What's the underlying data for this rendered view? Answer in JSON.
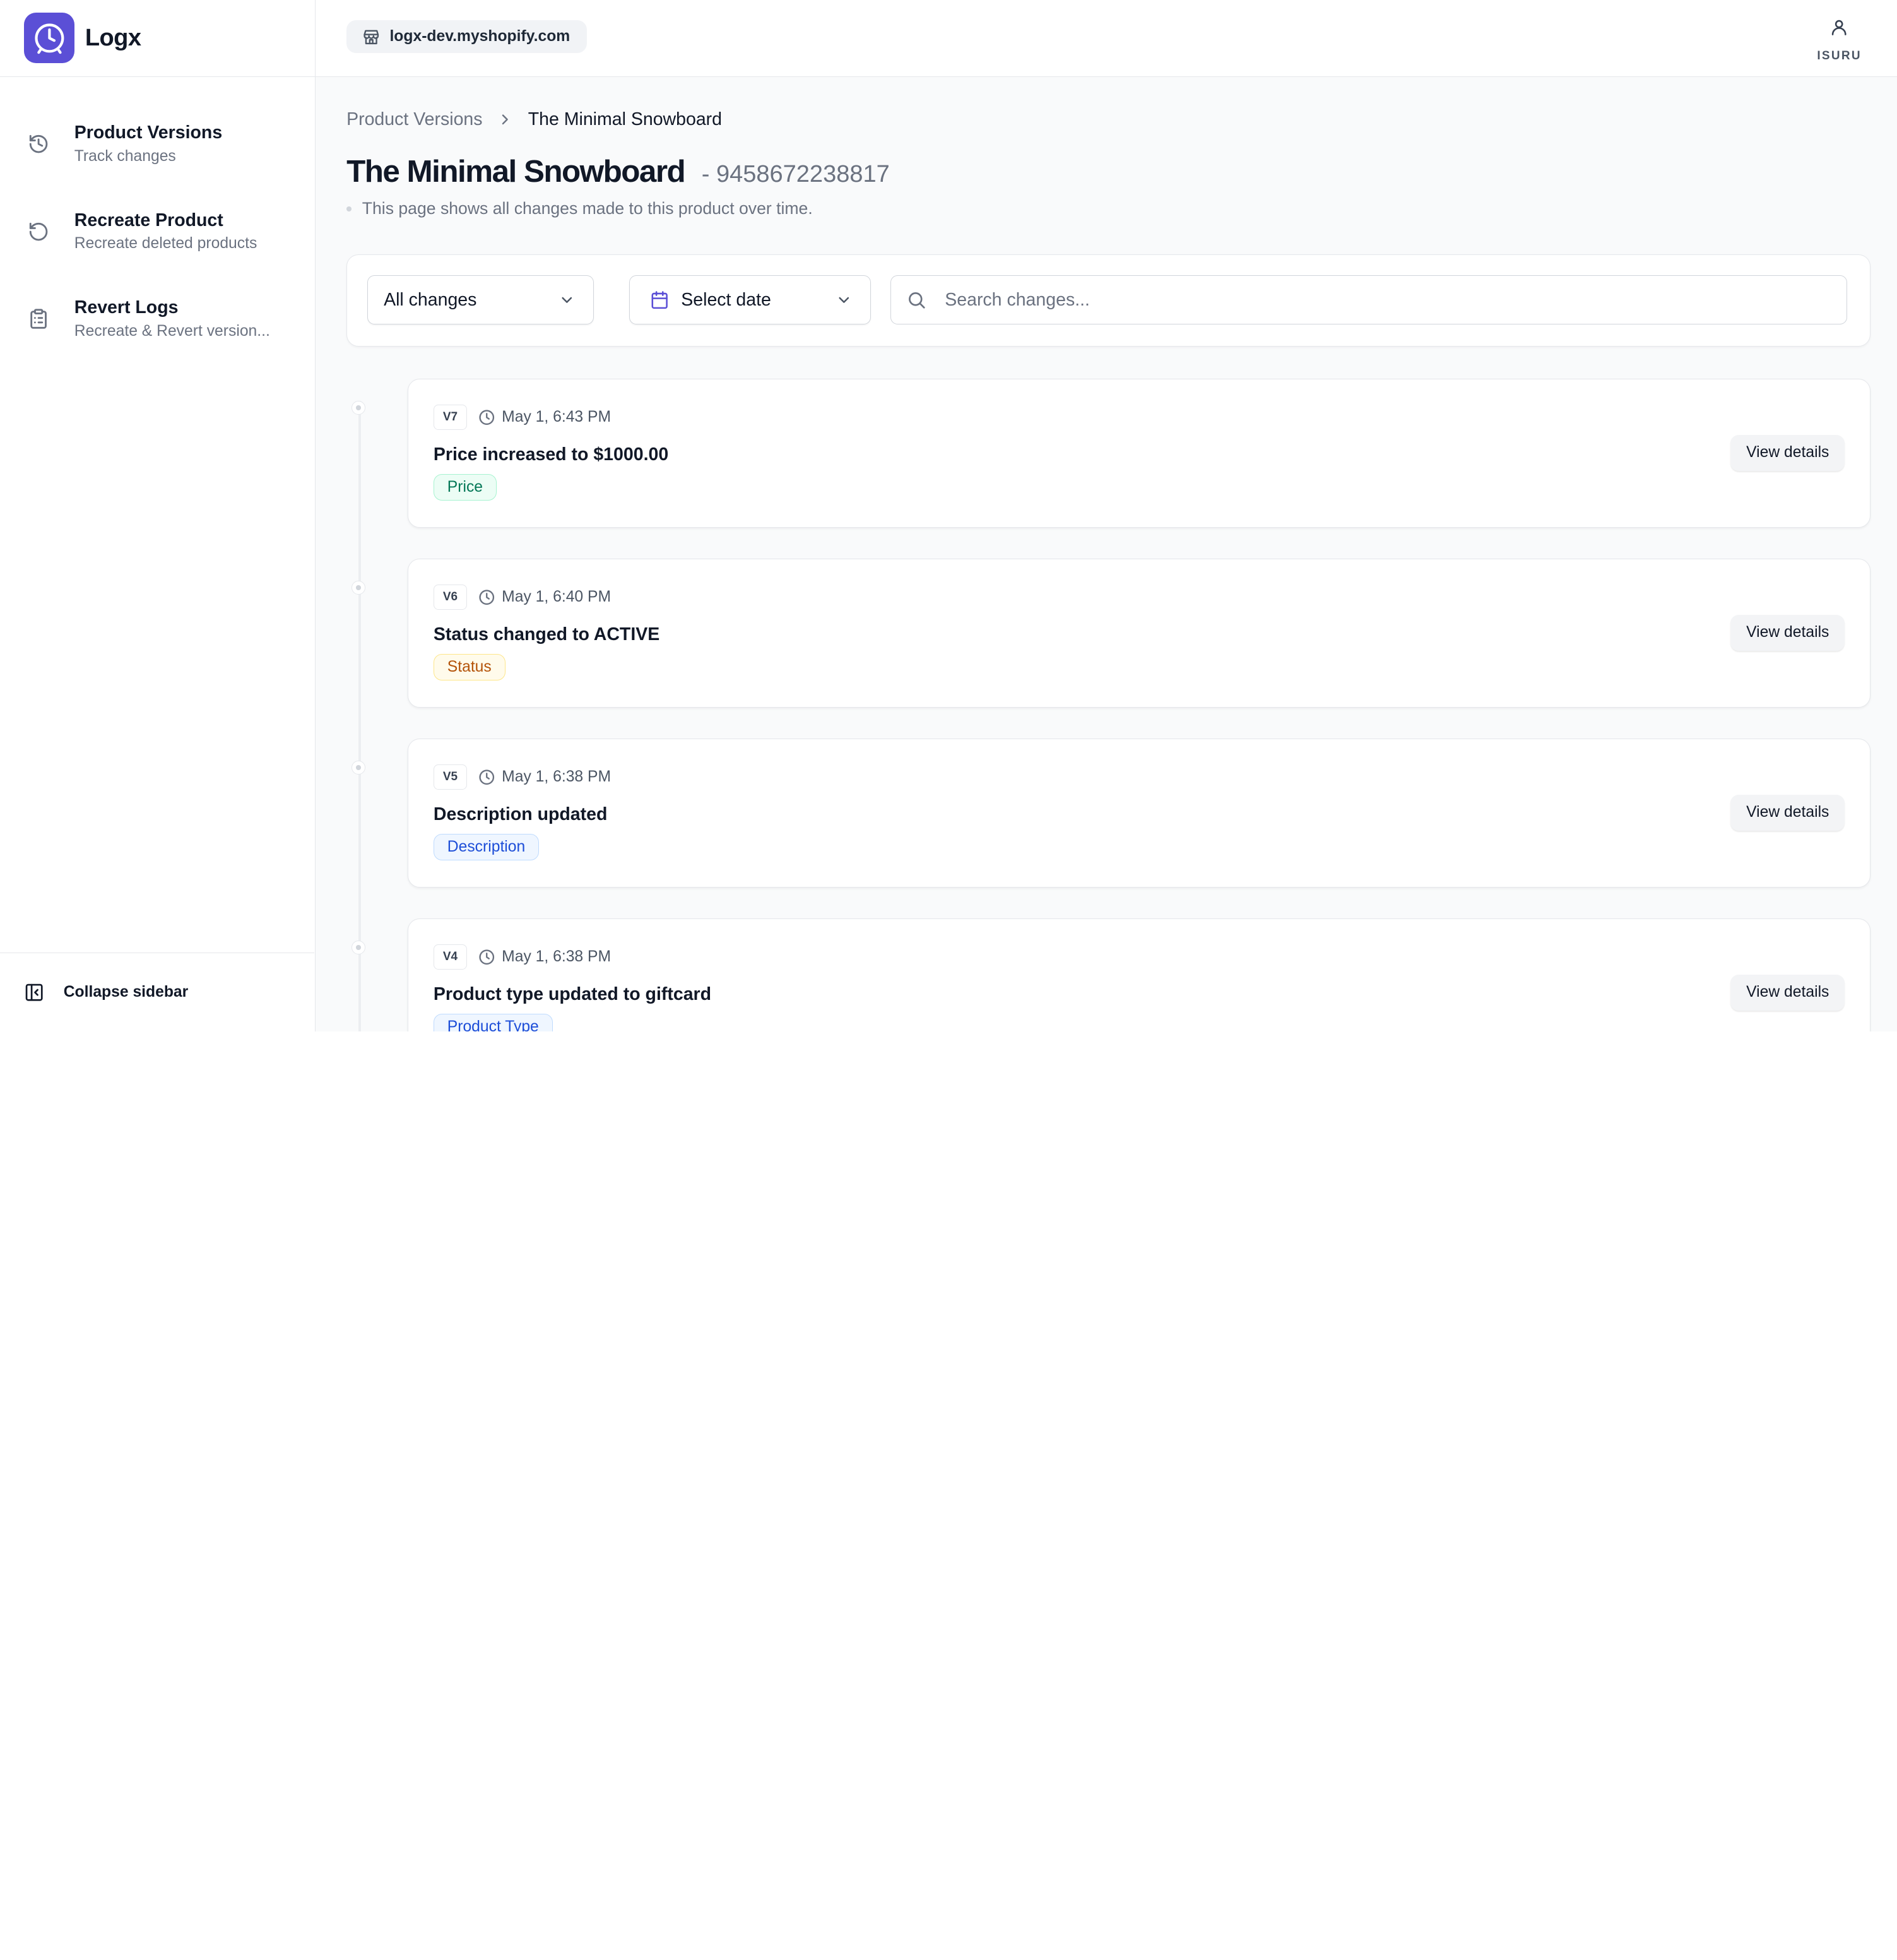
{
  "app": {
    "name": "Logx",
    "logo_icon": "clock-logo-icon",
    "brand_color": "#5b4fd6"
  },
  "sidebar": {
    "items": [
      {
        "icon": "history-icon",
        "title": "Product Versions",
        "subtitle": "Track changes"
      },
      {
        "icon": "rotate-ccw-icon",
        "title": "Recreate Product",
        "subtitle": "Recreate deleted products"
      },
      {
        "icon": "clipboard-list-icon",
        "title": "Revert Logs",
        "subtitle": "Recreate & Revert version..."
      }
    ],
    "collapse_label": "Collapse sidebar"
  },
  "topbar": {
    "store": "logx-dev.myshopify.com",
    "user": "ISURU"
  },
  "breadcrumb": {
    "parent": "Product Versions",
    "current": "The Minimal Snowboard"
  },
  "page": {
    "title": "The Minimal Snowboard",
    "product_id": "- 9458672238817",
    "subtitle": "This page shows all changes made to this product over time."
  },
  "filters": {
    "change_type": "All changes",
    "date": "Select date",
    "search_placeholder": "Search changes..."
  },
  "changes": [
    {
      "version": "V7",
      "time": "May 1, 6:43 PM",
      "title": "Price increased to $1000.00",
      "tag": "Price",
      "tag_colors": {
        "bg": "#ecfdf5",
        "border": "#a7f3d0",
        "text": "#047857"
      },
      "action": "View details"
    },
    {
      "version": "V6",
      "time": "May 1, 6:40 PM",
      "title": "Status changed to ACTIVE",
      "tag": "Status",
      "tag_colors": {
        "bg": "#fffbeb",
        "border": "#fde68a",
        "text": "#b45309"
      },
      "action": "View details"
    },
    {
      "version": "V5",
      "time": "May 1, 6:38 PM",
      "title": "Description updated",
      "tag": "Description",
      "tag_colors": {
        "bg": "#eff6ff",
        "border": "#bfdbfe",
        "text": "#1d4ed8"
      },
      "action": "View details"
    },
    {
      "version": "V4",
      "time": "May 1, 6:38 PM",
      "title": "Product type updated to giftcard",
      "tag": "Product Type",
      "tag_colors": {
        "bg": "#eff6ff",
        "border": "#bfdbfe",
        "text": "#1d4ed8"
      },
      "action": "View details"
    }
  ]
}
